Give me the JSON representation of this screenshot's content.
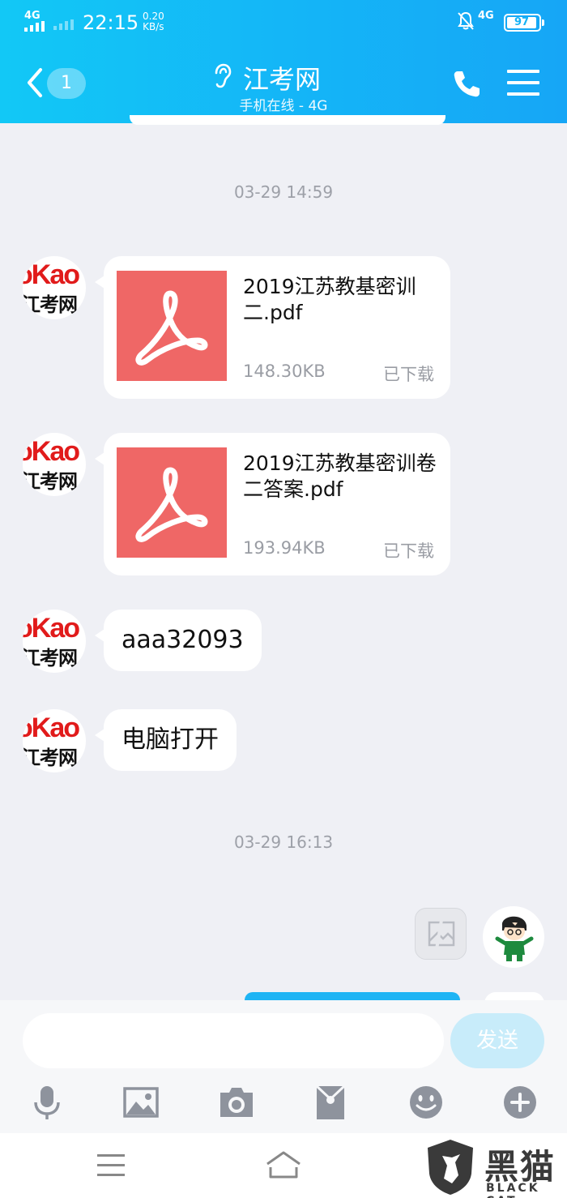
{
  "status_bar": {
    "network_left": "4G",
    "time": "22:15",
    "speed_value": "0.20",
    "speed_unit": "KB/s",
    "network_right": "4G",
    "battery": "97"
  },
  "header": {
    "unread_count": "1",
    "title": "江考网",
    "subtitle": "手机在线 - 4G"
  },
  "messages": {
    "timestamp_1": "03-29 14:59",
    "file_1": {
      "name": "2019江苏教基密训二.pdf",
      "size": "148.30KB",
      "status": "已下载"
    },
    "file_2": {
      "name": "2019江苏教基密训卷二答案.pdf",
      "size": "193.94KB",
      "status": "已下载"
    },
    "text_1": "aaa32093",
    "text_2": "电脑打开",
    "timestamp_2": "03-29 16:13"
  },
  "avatar": {
    "top_text": "oKao",
    "bottom_text": "江考网"
  },
  "input": {
    "value": "",
    "send_label": "发送"
  },
  "toolbar_icons": [
    "microphone-icon",
    "image-icon",
    "camera-icon",
    "red-packet-icon",
    "emoji-icon",
    "plus-icon"
  ],
  "watermark": {
    "cn": "黑猫",
    "en": "BLACK CAT"
  },
  "colors": {
    "header": "#14b6f7",
    "pdf": "#ef6766",
    "background": "#eff0f5",
    "send_button": "#c8ecfa"
  }
}
